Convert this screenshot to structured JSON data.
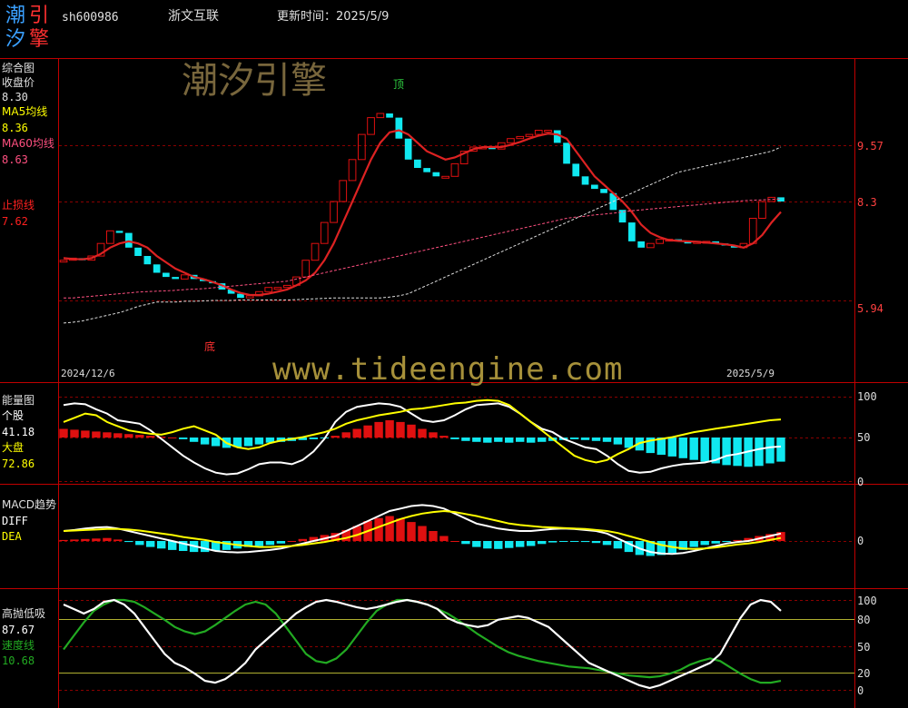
{
  "header": {
    "logo_chars": [
      "潮",
      "引",
      "汐",
      "擎"
    ],
    "code": "sh600986",
    "name": "浙文互联",
    "update_label": "更新时间：2025/5/9"
  },
  "watermarks": {
    "brand": "潮汐引擎",
    "url": "www.tideengine.com"
  },
  "colors": {
    "up": "#e01010",
    "down": "#10e8f0",
    "ma5": "#ffff00",
    "ma60": "#ff5080",
    "stop": "#ff2020",
    "white": "#ffffff",
    "green": "#22aa22",
    "grid": "#8a0000"
  },
  "panels": {
    "main": {
      "title": "综合图",
      "close_label": "收盘价",
      "close_value": "8.30",
      "ma5_label": "MA5均线",
      "ma5_value": "8.36",
      "ma60_label": "MA60均线",
      "ma60_value": "8.63",
      "stop_label": "止损线",
      "stop_value": "7.62",
      "top_marker": "顶",
      "bottom_marker": "底",
      "start_date": "2024/12/6",
      "end_date": "2025/5/9"
    },
    "energy": {
      "title": "能量图",
      "stock_label": "个股",
      "stock_value": "41.18",
      "market_label": "大盘",
      "market_value": "72.86"
    },
    "macd": {
      "title": "MACD趋势",
      "diff_label": "DIFF",
      "dea_label": "DEA"
    },
    "hilo": {
      "title": "高抛低吸",
      "value": "87.67",
      "speed_label": "速度线",
      "speed_value": "10.68"
    }
  },
  "chart_data": [
    {
      "type": "candlestick",
      "title": "综合图",
      "x_range": [
        "2024/12/6",
        "2025/5/9"
      ],
      "y_ticks": [
        9.57,
        8.3,
        5.94
      ],
      "close": [
        6.9,
        6.95,
        6.9,
        7.0,
        7.3,
        7.6,
        7.55,
        7.2,
        7.0,
        6.8,
        6.6,
        6.5,
        6.45,
        6.55,
        6.45,
        6.4,
        6.35,
        6.2,
        6.1,
        6.0,
        6.05,
        6.15,
        6.25,
        6.25,
        6.3,
        6.5,
        6.9,
        7.3,
        7.8,
        8.3,
        8.8,
        9.3,
        9.9,
        10.3,
        10.4,
        10.3,
        9.8,
        9.3,
        9.1,
        9.0,
        8.9,
        8.9,
        9.2,
        9.5,
        9.6,
        9.6,
        9.55,
        9.7,
        9.8,
        9.85,
        9.9,
        10.0,
        10.0,
        9.7,
        9.2,
        8.9,
        8.7,
        8.6,
        8.5,
        8.1,
        7.8,
        7.35,
        7.2,
        7.3,
        7.4,
        7.4,
        7.35,
        7.3,
        7.35,
        7.35,
        7.3,
        7.25,
        7.2,
        7.3,
        7.9,
        8.3,
        8.4,
        8.3
      ],
      "series": [
        {
          "name": "MA5均线",
          "values": [
            6.95,
            6.93,
            6.92,
            6.95,
            7.05,
            7.2,
            7.3,
            7.35,
            7.3,
            7.2,
            7.0,
            6.85,
            6.7,
            6.6,
            6.5,
            6.45,
            6.38,
            6.3,
            6.2,
            6.12,
            6.07,
            6.07,
            6.1,
            6.15,
            6.2,
            6.3,
            6.42,
            6.6,
            6.9,
            7.3,
            7.8,
            8.3,
            8.8,
            9.3,
            9.7,
            9.95,
            10.0,
            9.9,
            9.7,
            9.5,
            9.4,
            9.3,
            9.35,
            9.45,
            9.55,
            9.6,
            9.6,
            9.6,
            9.65,
            9.72,
            9.8,
            9.87,
            9.92,
            9.9,
            9.8,
            9.5,
            9.2,
            8.9,
            8.7,
            8.5,
            8.3,
            8.05,
            7.75,
            7.55,
            7.45,
            7.38,
            7.36,
            7.35,
            7.34,
            7.32,
            7.3,
            7.28,
            7.25,
            7.2,
            7.3,
            7.5,
            7.8,
            8.05
          ]
        },
        {
          "name": "MA60均线",
          "values": [
            6.0,
            6.0,
            6.02,
            6.04,
            6.06,
            6.08,
            6.1,
            6.12,
            6.14,
            6.15,
            6.16,
            6.17,
            6.18,
            6.2,
            6.21,
            6.22,
            6.24,
            6.26,
            6.28,
            6.3,
            6.32,
            6.34,
            6.36,
            6.38,
            6.4,
            6.45,
            6.5,
            6.55,
            6.6,
            6.65,
            6.7,
            6.75,
            6.8,
            6.85,
            6.9,
            6.95,
            7.0,
            7.05,
            7.1,
            7.15,
            7.2,
            7.25,
            7.3,
            7.35,
            7.4,
            7.45,
            7.5,
            7.55,
            7.6,
            7.65,
            7.7,
            7.75,
            7.8,
            7.85,
            7.9,
            7.93,
            7.95,
            7.98,
            8.0,
            8.02,
            8.05,
            8.08,
            8.1,
            8.12,
            8.14,
            8.16,
            8.18,
            8.2,
            8.22,
            8.24,
            8.26,
            8.28,
            8.3,
            8.32,
            8.33,
            8.34,
            8.35,
            8.36
          ]
        },
        {
          "name": "止损线",
          "values": [
            5.4,
            5.42,
            5.45,
            5.5,
            5.55,
            5.6,
            5.65,
            5.72,
            5.8,
            5.85,
            5.9,
            5.9,
            5.9,
            5.92,
            5.92,
            5.93,
            5.94,
            5.94,
            5.94,
            5.95,
            5.95,
            5.95,
            5.95,
            5.95,
            5.95,
            5.96,
            5.97,
            5.98,
            5.99,
            6.0,
            6.0,
            6.0,
            6.0,
            6.0,
            6.0,
            6.02,
            6.05,
            6.1,
            6.2,
            6.3,
            6.4,
            6.5,
            6.6,
            6.7,
            6.8,
            6.9,
            7.0,
            7.1,
            7.2,
            7.3,
            7.4,
            7.5,
            7.6,
            7.7,
            7.8,
            7.9,
            8.0,
            8.1,
            8.2,
            8.3,
            8.4,
            8.5,
            8.6,
            8.7,
            8.8,
            8.9,
            9.0,
            9.05,
            9.1,
            9.15,
            9.2,
            9.25,
            9.3,
            9.35,
            9.4,
            9.45,
            9.5,
            9.6
          ]
        }
      ]
    },
    {
      "type": "bar",
      "title": "能量图",
      "y_ticks": [
        100,
        50,
        0
      ],
      "series": [
        {
          "name": "个股",
          "values": [
            90,
            92,
            91,
            85,
            80,
            72,
            70,
            68,
            60,
            50,
            40,
            30,
            22,
            15,
            10,
            8,
            9,
            14,
            20,
            22,
            22,
            20,
            25,
            35,
            50,
            70,
            82,
            88,
            90,
            92,
            91,
            88,
            80,
            72,
            70,
            72,
            78,
            85,
            90,
            91,
            92,
            88,
            80,
            70,
            62,
            58,
            50,
            45,
            40,
            38,
            30,
            20,
            12,
            10,
            11,
            15,
            18,
            20,
            21,
            22,
            25,
            30,
            32,
            35,
            38,
            40,
            41
          ]
        },
        {
          "name": "大盘",
          "values": [
            70,
            75,
            80,
            78,
            70,
            65,
            60,
            58,
            56,
            55,
            58,
            62,
            65,
            60,
            55,
            45,
            40,
            38,
            40,
            45,
            48,
            50,
            52,
            55,
            58,
            62,
            68,
            72,
            75,
            78,
            80,
            82,
            85,
            86,
            88,
            90,
            92,
            93,
            95,
            96,
            95,
            90,
            80,
            70,
            60,
            50,
            40,
            30,
            25,
            22,
            25,
            32,
            38,
            45,
            48,
            50,
            52,
            55,
            58,
            60,
            62,
            64,
            66,
            68,
            70,
            72,
            73
          ]
        },
        {
          "name": "bars",
          "values": [
            10,
            9,
            8,
            7,
            6,
            5,
            4,
            3,
            2,
            1,
            0,
            -2,
            -5,
            -8,
            -10,
            -12,
            -11,
            -10,
            -8,
            -6,
            -5,
            -4,
            -3,
            -2,
            -1,
            2,
            6,
            10,
            14,
            18,
            20,
            18,
            15,
            10,
            6,
            2,
            -2,
            -4,
            -5,
            -6,
            -5,
            -6,
            -5,
            -6,
            -5,
            -4,
            -3,
            -2,
            -3,
            -4,
            -5,
            -8,
            -12,
            -15,
            -18,
            -20,
            -22,
            -24,
            -26,
            -28,
            -30,
            -32,
            -33,
            -34,
            -33,
            -30,
            -28
          ]
        }
      ]
    },
    {
      "type": "bar",
      "title": "MACD趋势",
      "y_ticks": [
        0
      ],
      "series": [
        {
          "name": "DIFF",
          "values": [
            0.2,
            0.22,
            0.25,
            0.27,
            0.28,
            0.25,
            0.2,
            0.15,
            0.1,
            0.05,
            0,
            -0.05,
            -0.1,
            -0.15,
            -0.2,
            -0.22,
            -0.23,
            -0.22,
            -0.2,
            -0.18,
            -0.15,
            -0.1,
            -0.05,
            0,
            0.05,
            0.1,
            0.2,
            0.3,
            0.4,
            0.5,
            0.6,
            0.65,
            0.7,
            0.72,
            0.7,
            0.65,
            0.55,
            0.45,
            0.35,
            0.3,
            0.25,
            0.22,
            0.2,
            0.2,
            0.22,
            0.24,
            0.25,
            0.24,
            0.22,
            0.2,
            0.15,
            0.05,
            -0.05,
            -0.15,
            -0.22,
            -0.25,
            -0.26,
            -0.24,
            -0.2,
            -0.15,
            -0.1,
            -0.05,
            -0.02,
            0,
            0.05,
            0.1,
            0.15
          ]
        },
        {
          "name": "DEA",
          "values": [
            0.2,
            0.21,
            0.22,
            0.23,
            0.24,
            0.24,
            0.23,
            0.21,
            0.18,
            0.15,
            0.12,
            0.08,
            0.05,
            0.02,
            -0.02,
            -0.05,
            -0.08,
            -0.1,
            -0.12,
            -0.12,
            -0.11,
            -0.1,
            -0.08,
            -0.05,
            -0.02,
            0.02,
            0.06,
            0.12,
            0.2,
            0.28,
            0.36,
            0.44,
            0.5,
            0.55,
            0.58,
            0.6,
            0.58,
            0.54,
            0.5,
            0.45,
            0.4,
            0.35,
            0.32,
            0.3,
            0.28,
            0.27,
            0.26,
            0.25,
            0.24,
            0.22,
            0.2,
            0.16,
            0.1,
            0.04,
            -0.02,
            -0.08,
            -0.12,
            -0.15,
            -0.16,
            -0.15,
            -0.13,
            -0.1,
            -0.07,
            -0.05,
            -0.02,
            0.02,
            0.06
          ]
        },
        {
          "name": "bars",
          "values": [
            0.02,
            0.03,
            0.04,
            0.05,
            0.06,
            0.03,
            -0.02,
            -0.08,
            -0.12,
            -0.15,
            -0.18,
            -0.2,
            -0.22,
            -0.22,
            -0.2,
            -0.18,
            -0.15,
            -0.12,
            -0.1,
            -0.08,
            -0.05,
            0,
            0.04,
            0.08,
            0.12,
            0.16,
            0.22,
            0.3,
            0.4,
            0.46,
            0.5,
            0.45,
            0.38,
            0.3,
            0.2,
            0.1,
            0,
            -0.06,
            -0.12,
            -0.15,
            -0.16,
            -0.14,
            -0.12,
            -0.1,
            -0.06,
            -0.03,
            -0.01,
            -0.01,
            -0.02,
            -0.04,
            -0.08,
            -0.15,
            -0.22,
            -0.28,
            -0.3,
            -0.28,
            -0.24,
            -0.18,
            -0.12,
            -0.08,
            -0.05,
            -0.02,
            0.02,
            0.06,
            0.1,
            0.14,
            0.18
          ]
        }
      ]
    },
    {
      "type": "line",
      "title": "高抛低吸",
      "y_ticks": [
        100,
        80,
        50,
        20,
        0
      ],
      "series": [
        {
          "name": "高抛低吸",
          "values": [
            95,
            90,
            85,
            90,
            98,
            100,
            95,
            85,
            70,
            55,
            40,
            30,
            25,
            18,
            10,
            8,
            12,
            20,
            30,
            45,
            55,
            65,
            75,
            85,
            92,
            98,
            100,
            98,
            95,
            92,
            90,
            92,
            95,
            98,
            100,
            98,
            95,
            90,
            80,
            75,
            72,
            70,
            72,
            78,
            80,
            82,
            80,
            75,
            70,
            60,
            50,
            40,
            30,
            25,
            20,
            15,
            10,
            5,
            2,
            5,
            10,
            15,
            20,
            25,
            30,
            40,
            60,
            80,
            95,
            100,
            98,
            88
          ]
        },
        {
          "name": "速度线",
          "values": [
            45,
            60,
            75,
            88,
            95,
            100,
            100,
            98,
            92,
            85,
            78,
            70,
            65,
            62,
            65,
            72,
            80,
            88,
            95,
            98,
            95,
            85,
            70,
            55,
            40,
            32,
            30,
            35,
            45,
            60,
            75,
            88,
            95,
            100,
            100,
            98,
            95,
            90,
            85,
            78,
            70,
            62,
            55,
            48,
            42,
            38,
            35,
            32,
            30,
            28,
            26,
            25,
            24,
            22,
            20,
            18,
            16,
            15,
            14,
            15,
            18,
            22,
            28,
            32,
            35,
            32,
            25,
            18,
            12,
            8,
            8,
            10
          ]
        }
      ]
    }
  ]
}
